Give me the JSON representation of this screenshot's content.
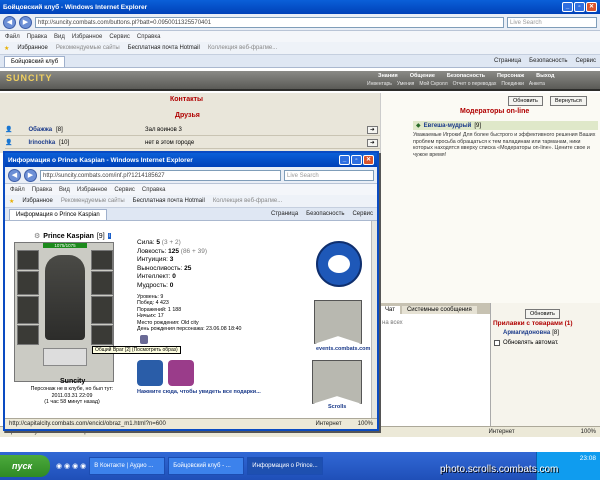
{
  "main_window": {
    "title": "Бойцовский клуб - Windows Internet Explorer",
    "url": "http://suncity.combats.com/buttons.pl?batt=0.0950011325570401",
    "search_placeholder": "Live Search",
    "menu": [
      "Файл",
      "Правка",
      "Вид",
      "Избранное",
      "Сервис",
      "Справка"
    ],
    "favorites": "Избранное",
    "fav_items": [
      "Рекомендуемые сайты",
      "Бесплатная почта Hotmail",
      "Коллекция веб-фрагме..."
    ],
    "tab": "Бойцовский клуб",
    "toolbar_right": [
      "Страница",
      "Безопасность",
      "Сервис"
    ],
    "status_url": "http://suncity.combats.com/inf.pl?1214185627",
    "status_zone": "Интернет",
    "zoom": "100%"
  },
  "site": {
    "logo": "SUNCITY",
    "nav_top": [
      "Знания",
      "Общение",
      "Безопасность",
      "Персонаж",
      "Выход"
    ],
    "nav_bottom": [
      "Инвентарь",
      "Умения",
      "Мой Скролл",
      "Отчет о переводах",
      "Поединки",
      "Анкета"
    ],
    "contacts": "Контакты",
    "friends": "Друзья",
    "friend_rows": [
      {
        "name": "Обажжа",
        "level": "[8]",
        "status": "Зал воинов 3"
      },
      {
        "name": "Irinochka",
        "level": "[10]",
        "status": "нет в этом городе"
      }
    ],
    "refresh": "Обновить",
    "back": "Вернуться",
    "moderators": "Модераторы on-line",
    "moderator": "Евгеша-мудрый",
    "moderator_level": "[9]",
    "notice": "Уважаемые Игроки! Для более быстрого и эффективного решения Ваших проблем просьба обращаться к тем паладинам или тарманам, ники которых находятся вверху списка «Модераторы on-line». Цените свое и чужое время!",
    "chat_tabs": [
      "Чат",
      "Системные сообщения"
    ],
    "chat_stub": "на всех",
    "stall_refresh": "Обновить",
    "stall_title": "Прилавки с товарами (1)",
    "stall_user": "Армагидоновна",
    "stall_user_level": "[8]",
    "auto_refresh": "Обновлять автомат."
  },
  "popup": {
    "title": "Информация о Prince Kaspian - Windows Internet Explorer",
    "url": "http://suncity.combats.com/inf.pl?1214185627",
    "search_placeholder": "Live Search",
    "menu": [
      "Файл",
      "Правка",
      "Вид",
      "Избранное",
      "Сервис",
      "Справка"
    ],
    "favorites": "Избранное",
    "fav_items": [
      "Рекомендуемые сайты",
      "Бесплатная почта Hotmail",
      "Коллекция веб-фрагме..."
    ],
    "tab": "Информация о Prince Kaspian",
    "toolbar_right": [
      "Страница",
      "Безопасность",
      "Сервис"
    ],
    "char_name": "Prince Kaspian",
    "char_level": "[9]",
    "hp": "1075/1075",
    "stats": [
      {
        "label": "Сила:",
        "value": "5",
        "extra": "(3 + 2)"
      },
      {
        "label": "Ловкость:",
        "value": "125",
        "extra": "(86 + 39)"
      },
      {
        "label": "Интуиция:",
        "value": "3",
        "extra": ""
      },
      {
        "label": "Выносливость:",
        "value": "25",
        "extra": ""
      },
      {
        "label": "Интеллект:",
        "value": "0",
        "extra": ""
      },
      {
        "label": "Мудрость:",
        "value": "0",
        "extra": ""
      }
    ],
    "info": [
      "Уровень: 9",
      "Побед: 4 423",
      "Поражений: 1 188",
      "Ничьих: 17",
      "Место рождения: Old city",
      "День рождения персонажа: 23.06.08 18:40"
    ],
    "tooltip": "Общий Враг [2] (Посмотреть образ)",
    "gifts_link": "Нажмите сюда, чтобы увидеть все подарки...",
    "city": "Suncity",
    "offline": "Персонаж не в клубе, но был тут:",
    "last_seen": "2011.03.31 22:09",
    "ago": "(1 час 58 минут назад)",
    "side_link": "events.combats.com",
    "scrolls": "Scrolls",
    "status_url": "http://capitalcity.combats.com/encicl/obraz_m1.html?n=600",
    "status_zone": "Интернет",
    "zoom": "100%"
  },
  "taskbar": {
    "start": "пуск",
    "buttons": [
      "В Контакте | Аудио ...",
      "Бойцовский клуб - ...",
      "Информация о Prince..."
    ],
    "clock": "23:08"
  },
  "watermark": "photo.scrolls.combats.com",
  "colors": {
    "xp_blue": "#0a5fd8",
    "site_red": "#b00000",
    "name_blue": "#1a3a8a"
  }
}
